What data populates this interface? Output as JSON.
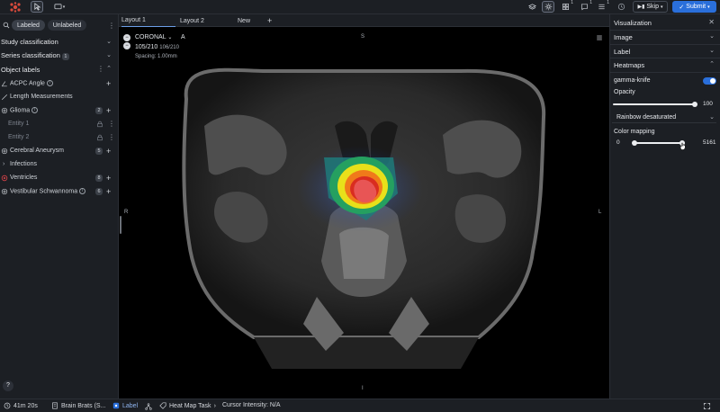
{
  "topbar": {
    "badges": {
      "layers": "1",
      "grid": "1",
      "comment": "1",
      "list": "1"
    },
    "skip_label": "Skip",
    "submit_label": "Submit"
  },
  "left": {
    "filters": [
      "Labeled",
      "Unlabeled"
    ],
    "sections": {
      "study": "Study classification",
      "series": "Series classification",
      "series_count": "1",
      "object_labels": "Object labels"
    },
    "items": [
      {
        "label": "ACPC Angle",
        "count": ""
      },
      {
        "label": "Length Measurements",
        "count": ""
      },
      {
        "label": "Glioma",
        "count": "2"
      },
      {
        "label": "Entity 1",
        "count": ""
      },
      {
        "label": "Entity 2",
        "count": ""
      },
      {
        "label": "Cerebral Aneurysm",
        "count": "5"
      },
      {
        "label": "Infections",
        "count": ""
      },
      {
        "label": "Ventricles",
        "count": "8"
      },
      {
        "label": "Vestibular Schwannoma",
        "count": "6"
      }
    ],
    "help": "?"
  },
  "viewer": {
    "tabs": [
      "Layout 1",
      "Layout 2",
      "New"
    ],
    "orientation": "CORONAL",
    "anterior": "A",
    "slice": "105/210",
    "slice_secondary": "106/210",
    "spacing": "Spacing: 1.00mm",
    "markers": {
      "top": "S",
      "left": "R",
      "right": "L",
      "bottom": "I"
    }
  },
  "right": {
    "visualization": "Visualization",
    "image": "Image",
    "label": "Label",
    "heatmaps": "Heatmaps",
    "heatmap_name": "gamma-knife",
    "heatmap_on": true,
    "opacity_label": "Opacity",
    "opacity_value": "100",
    "colormap": "Rainbow desaturated",
    "color_mapping_label": "Color mapping",
    "color_min": "0",
    "color_max": "5161"
  },
  "status": {
    "timer": "41m 20s",
    "dataset": "Brain Brats (S...",
    "label_mode": "Label",
    "task": "Heat Map Task",
    "cursor": "Cursor Intensity: N/A"
  },
  "colors": {
    "accent": "#2a6fdb",
    "background": "#14161a",
    "panel": "#1c1f24"
  }
}
